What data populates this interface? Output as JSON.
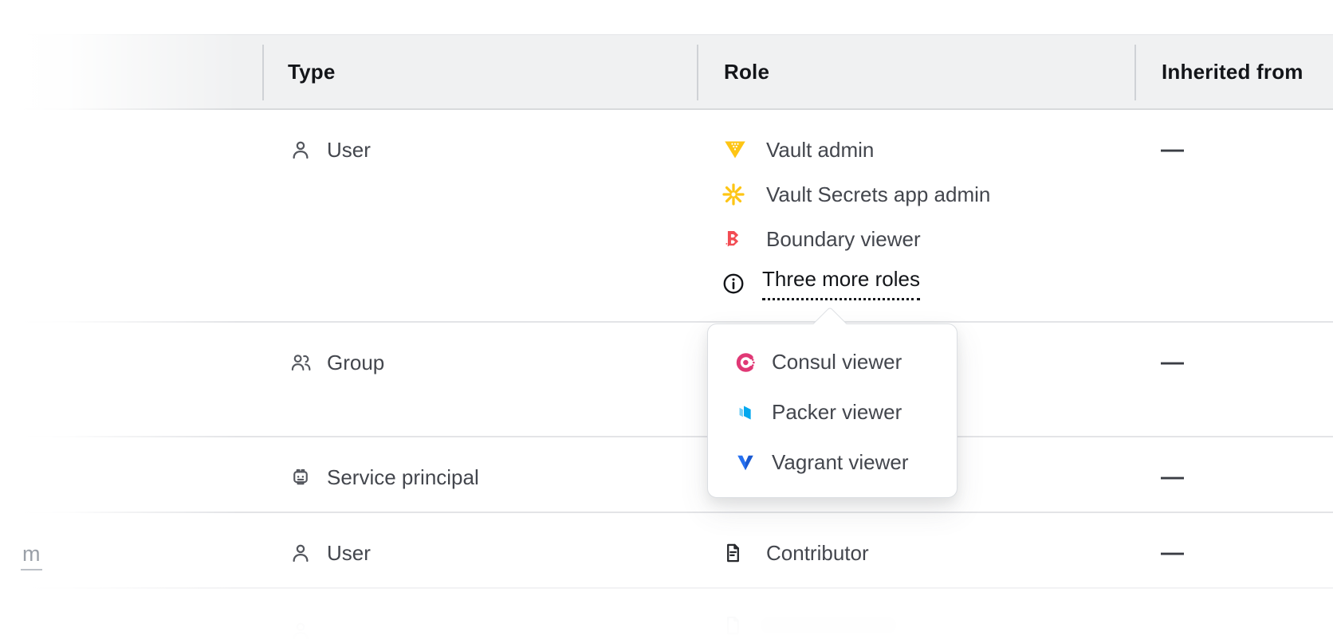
{
  "table": {
    "columns": {
      "type": "Type",
      "role": "Role",
      "inherited_from": "Inherited from"
    },
    "rows": [
      {
        "type": "User",
        "roles": [
          "Vault admin",
          "Vault Secrets app admin",
          "Boundary viewer"
        ],
        "more_roles_link": "Three more roles",
        "inherited_from": "—"
      },
      {
        "type": "Group",
        "inherited_from": "—"
      },
      {
        "type": "Service principal",
        "inherited_from": "—"
      },
      {
        "principal_visible_text": "m",
        "type": "User",
        "roles": [
          "Contributor"
        ],
        "inherited_from": "—"
      }
    ]
  },
  "popover": {
    "items": [
      "Consul viewer",
      "Packer viewer",
      "Vagrant viewer"
    ]
  },
  "icons": {
    "row_types": [
      "user-icon",
      "group-icon",
      "service-principal-robot-icon",
      "user-icon"
    ],
    "role_icons": [
      "vault-triangle-icon",
      "vault-secrets-asterisk-icon",
      "boundary-icon",
      "info-icon",
      "contributor-document-icon"
    ],
    "popover_icons": [
      "consul-icon",
      "packer-icon",
      "vagrant-icon"
    ]
  },
  "colors": {
    "header_bg": "#F0F1F2",
    "divider": "#E3E4E7",
    "text_primary": "#131519",
    "text_body": "#43464D",
    "text_muted": "#9AA0A8",
    "vault": "#FEC514",
    "boundary": "#F24C53",
    "consul": "#E03875",
    "packer": "#02A8EF",
    "vagrant_light": "#2570F1",
    "vagrant_dark": "#1959D1"
  }
}
